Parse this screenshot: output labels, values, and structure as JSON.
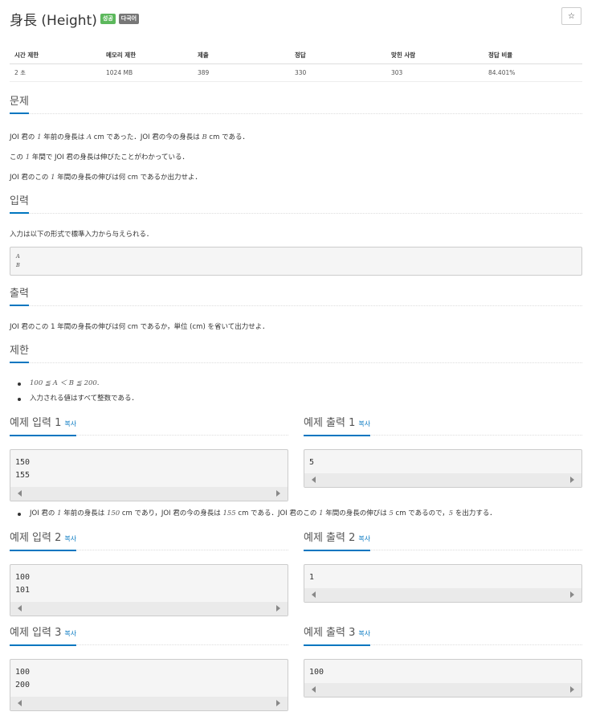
{
  "problem": {
    "title": "身長 (Height)",
    "badges": [
      "성공",
      "다국어"
    ],
    "star_label": "☆"
  },
  "info_table": {
    "headers": [
      "시간 제한",
      "메모리 제한",
      "제출",
      "정답",
      "맞힌 사람",
      "정답 비율"
    ],
    "values": [
      "2 초",
      "1024 MB",
      "389",
      "330",
      "303",
      "84.401%"
    ]
  },
  "sections": {
    "problem": "문제",
    "input": "입력",
    "output": "출력",
    "limits": "제한"
  },
  "problem_text": {
    "line1": [
      "JOI 君の ",
      "1",
      " 年前の身長は ",
      "A",
      " cm であった．JOI 君の今の身長は ",
      "B",
      " cm である．"
    ],
    "line2": [
      "この ",
      "1",
      " 年間で JOI 君の身長は伸びたことがわかっている．"
    ],
    "line3": [
      "JOI 君のこの ",
      "1",
      " 年間の身長の伸びは何 cm であるか出力せよ．"
    ]
  },
  "input_text": "入力は以下の形式で標準入力から与えられる．",
  "input_format": [
    "A",
    "B"
  ],
  "output_text": "JOI 君のこの 1 年間の身長の伸びは何 cm であるか，単位 (cm) を省いて出力せよ．",
  "limits": {
    "item1": "100 ≦ A ＜ B ≦ 200",
    "item1_end": ".",
    "item2": "入力される値はすべて整数である．"
  },
  "examples": {
    "copy_label": "복사",
    "input1_title": "예제 입력 1",
    "output1_title": "예제 출력 1",
    "input1": "150\n155",
    "output1": "5",
    "note1": [
      "JOI 君の ",
      "1",
      " 年前の身長は ",
      "150",
      " cm であり，JOI 君の今の身長は ",
      "155",
      " cm である．JOI 君のこの ",
      "1",
      " 年間の身長の伸びは ",
      "5",
      " cm であるので，",
      "5",
      " を出力する．"
    ],
    "input2_title": "예제 입력 2",
    "output2_title": "예제 출력 2",
    "input2": "100\n101",
    "output2": "1",
    "input3_title": "예제 입력 3",
    "output3_title": "예제 출력 3",
    "input3": "100\n200",
    "output3": "100"
  },
  "colors": {
    "accent": "#0076c0",
    "badge_success": "#5cb85c",
    "badge_lang": "#777777"
  }
}
